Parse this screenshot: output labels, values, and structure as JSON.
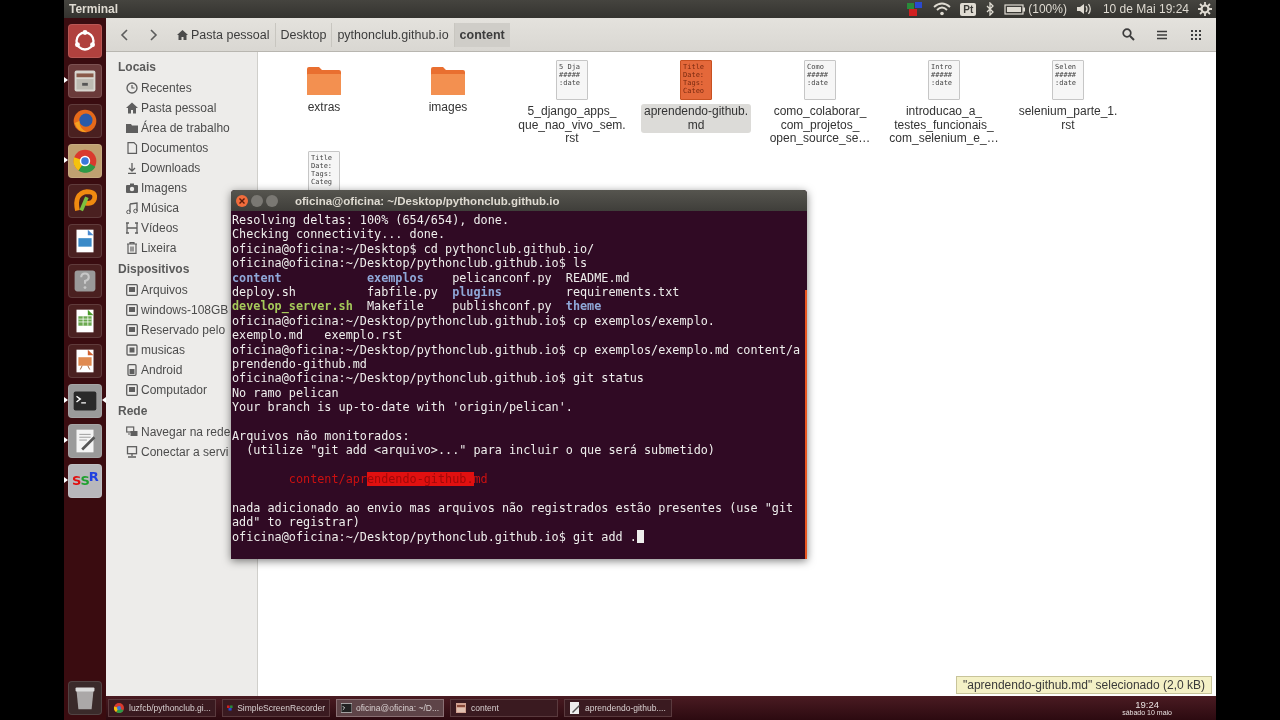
{
  "top_panel": {
    "title": "Terminal",
    "indicators": [
      {
        "kind": "ssr"
      },
      {
        "kind": "wifi"
      },
      {
        "kind": "keyboard",
        "text": "Pt"
      },
      {
        "kind": "bluetooth"
      },
      {
        "kind": "battery",
        "text": "(100%)"
      },
      {
        "kind": "volume"
      },
      {
        "kind": "clock",
        "text": "10 de Mai 19:24"
      },
      {
        "kind": "gear"
      }
    ]
  },
  "launcher": [
    {
      "kind": "dash",
      "running": false,
      "focused": false
    },
    {
      "kind": "files",
      "running": true,
      "focused": false
    },
    {
      "kind": "firefox",
      "running": false,
      "focused": false
    },
    {
      "kind": "chrome",
      "running": true,
      "focused": false
    },
    {
      "kind": "swirl",
      "running": false,
      "focused": false
    },
    {
      "kind": "draw",
      "running": false,
      "focused": false
    },
    {
      "kind": "help",
      "running": false,
      "focused": false
    },
    {
      "kind": "calc",
      "running": false,
      "focused": false
    },
    {
      "kind": "impress",
      "running": false,
      "focused": false
    },
    {
      "kind": "terminal",
      "running": true,
      "focused": true
    },
    {
      "kind": "editor",
      "running": true,
      "focused": false
    },
    {
      "kind": "ssr",
      "label": "SSR",
      "running": true,
      "focused": false
    },
    {
      "kind": "trash",
      "running": false,
      "focused": false
    }
  ],
  "file_manager": {
    "breadcrumbs": [
      {
        "label": "Pasta pessoal",
        "kind": "home",
        "selected": false
      },
      {
        "label": "Desktop",
        "kind": "plain",
        "selected": false
      },
      {
        "label": "pythonclub.github.io",
        "kind": "plain",
        "selected": false
      },
      {
        "label": "content",
        "kind": "plain",
        "selected": true
      }
    ],
    "sidebar": [
      {
        "heading": "Locais",
        "items": [
          {
            "label": "Recentes",
            "kind": "clock"
          },
          {
            "label": "Pasta pessoal",
            "kind": "home"
          },
          {
            "label": "Área de trabalho",
            "kind": "folder"
          },
          {
            "label": "Documentos",
            "kind": "document"
          },
          {
            "label": "Downloads",
            "kind": "download"
          },
          {
            "label": "Imagens",
            "kind": "camera"
          },
          {
            "label": "Música",
            "kind": "music"
          },
          {
            "label": "Vídeos",
            "kind": "video"
          },
          {
            "label": "Lixeira",
            "kind": "trash"
          }
        ]
      },
      {
        "heading": "Dispositivos",
        "items": [
          {
            "label": "Arquivos",
            "kind": "drive"
          },
          {
            "label": "windows-108GB",
            "kind": "drive"
          },
          {
            "label": "Reservado pelo",
            "kind": "drive"
          },
          {
            "label": "musicas",
            "kind": "disk"
          },
          {
            "label": "Android",
            "kind": "phone"
          },
          {
            "label": "Computador",
            "kind": "drive"
          }
        ]
      },
      {
        "heading": "Rede",
        "items": [
          {
            "label": "Navegar na rede",
            "kind": "network"
          },
          {
            "label": "Conectar a servi",
            "kind": "server"
          }
        ]
      }
    ],
    "files": [
      {
        "kind": "folder",
        "label": "extras",
        "selected": false
      },
      {
        "kind": "folder",
        "label": "images",
        "selected": false
      },
      {
        "kind": "document",
        "preview": [
          "5 Dja",
          "#####",
          ":date"
        ],
        "label": "5_django_apps_\nque_nao_vivo_sem.\nrst",
        "selected": false
      },
      {
        "kind": "document",
        "preview": [
          "Title",
          "Date:",
          "Tags:",
          "Cateo"
        ],
        "label": "aprendendo-github.\nmd",
        "selected": true
      },
      {
        "kind": "document",
        "preview": [
          "Como",
          "#####",
          ":date"
        ],
        "label": "como_colaborar_\ncom_projetos_\nopen_source_se…",
        "selected": false
      },
      {
        "kind": "document",
        "preview": [
          "Intro",
          "#####",
          ":date"
        ],
        "label": "introducao_a_\ntestes_funcionais_\ncom_selenium_e_…",
        "selected": false
      },
      {
        "kind": "document",
        "preview": [
          "Selen",
          "#####",
          ":date"
        ],
        "label": "selenium_parte_1.\nrst",
        "selected": false
      },
      {
        "kind": "document",
        "preview": [
          "Title",
          "Date:",
          "Tags:",
          "Categ"
        ],
        "selected": false
      }
    ],
    "status": "\"aprendendo-github.md\" selecionado (2,0 kB)"
  },
  "terminal": {
    "title": "oficina@oficina: ~/Desktop/pythonclub.github.io",
    "lines": [
      {
        "kind": "text",
        "segments": [
          {
            "text": "Resolving deltas: 100% (654/654), done.",
            "kind": "plain"
          }
        ]
      },
      {
        "kind": "text",
        "segments": [
          {
            "text": "Checking connectivity... done.",
            "kind": "plain"
          }
        ]
      },
      {
        "kind": "text",
        "segments": [
          {
            "text": "oficina@oficina:~/Desktop$ cd pythonclub.github.io/",
            "kind": "plain"
          }
        ]
      },
      {
        "kind": "text",
        "segments": [
          {
            "text": "oficina@oficina:~/Desktop/pythonclub.github.io$ ls",
            "kind": "plain"
          }
        ]
      },
      {
        "kind": "columns",
        "cells": [
          {
            "text": "content",
            "kind": "dir"
          },
          {
            "text": "exemplos",
            "kind": "dir"
          },
          {
            "text": "pelicanconf.py",
            "kind": "plain"
          },
          {
            "text": "README.md",
            "kind": "plain"
          }
        ]
      },
      {
        "kind": "columns",
        "cells": [
          {
            "text": "deploy.sh",
            "kind": "plain"
          },
          {
            "text": "fabfile.py",
            "kind": "plain"
          },
          {
            "text": "plugins",
            "kind": "dir"
          },
          {
            "text": "requirements.txt",
            "kind": "plain"
          }
        ]
      },
      {
        "kind": "columns",
        "cells": [
          {
            "text": "develop_server.sh",
            "kind": "exec"
          },
          {
            "text": "Makefile",
            "kind": "plain"
          },
          {
            "text": "publishconf.py",
            "kind": "plain"
          },
          {
            "text": "theme",
            "kind": "dir"
          }
        ]
      },
      {
        "kind": "text",
        "segments": [
          {
            "text": "oficina@oficina:~/Desktop/pythonclub.github.io$ cp exemplos/exemplo.",
            "kind": "plain"
          }
        ]
      },
      {
        "kind": "text",
        "segments": [
          {
            "text": "exemplo.md   exemplo.rst",
            "kind": "plain"
          }
        ]
      },
      {
        "kind": "text",
        "segments": [
          {
            "text": "oficina@oficina:~/Desktop/pythonclub.github.io$ cp exemplos/exemplo.md content/a",
            "kind": "plain"
          }
        ]
      },
      {
        "kind": "text",
        "segments": [
          {
            "text": "prendendo-github.md",
            "kind": "plain"
          }
        ]
      },
      {
        "kind": "text",
        "segments": [
          {
            "text": "oficina@oficina:~/Desktop/pythonclub.github.io$ git status",
            "kind": "plain"
          }
        ]
      },
      {
        "kind": "text",
        "segments": [
          {
            "text": "No ramo pelican",
            "kind": "plain"
          }
        ]
      },
      {
        "kind": "text",
        "segments": [
          {
            "text": "Your branch is up-to-date with 'origin/pelican'.",
            "kind": "plain"
          }
        ]
      },
      {
        "kind": "blank"
      },
      {
        "kind": "text",
        "segments": [
          {
            "text": "Arquivos não monitorados:",
            "kind": "plain"
          }
        ]
      },
      {
        "kind": "text",
        "segments": [
          {
            "text": "  (utilize \"git add <arquivo>...\" para incluir o que será submetido)",
            "kind": "plain"
          }
        ]
      },
      {
        "kind": "blank"
      },
      {
        "kind": "text",
        "segments": [
          {
            "text": "        content/apr",
            "kind": "error"
          },
          {
            "text": "endendo-github.",
            "kind": "highlight"
          },
          {
            "text": "md",
            "kind": "error"
          }
        ]
      },
      {
        "kind": "blank"
      },
      {
        "kind": "text",
        "segments": [
          {
            "text": "nada adicionado ao envio mas arquivos não registrados estão presentes (use \"git",
            "kind": "plain"
          }
        ]
      },
      {
        "kind": "text",
        "segments": [
          {
            "text": "add\" to registrar)",
            "kind": "plain"
          }
        ]
      },
      {
        "kind": "text",
        "segments": [
          {
            "text": "oficina@oficina:~/Desktop/pythonclub.github.io$ git add .",
            "kind": "plain"
          },
          {
            "kind": "cursor"
          }
        ]
      }
    ]
  },
  "taskbar": {
    "items": [
      {
        "label": "luzfcb/pythonclub.gi...",
        "kind": "chrome",
        "selected": false
      },
      {
        "label": "SimpleScreenRecorder",
        "kind": "ssr",
        "selected": false
      },
      {
        "label": "oficina@oficina: ~/D...",
        "kind": "terminal",
        "selected": true
      },
      {
        "label": "content",
        "kind": "folder",
        "selected": false
      },
      {
        "label": "aprendendo-github....",
        "kind": "editor",
        "selected": false
      }
    ],
    "time": "19:24",
    "date": "sábado 10 maio"
  }
}
